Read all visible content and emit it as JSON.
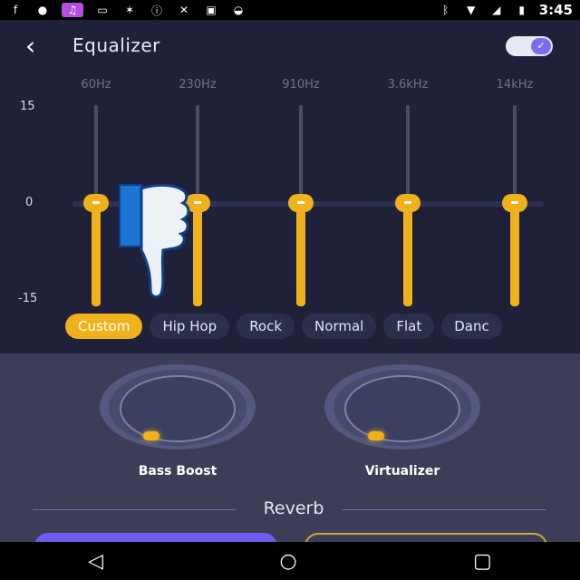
{
  "status_bar": {
    "time": "3:45",
    "icons_left": [
      "facebook-icon",
      "person-icon",
      "music-icon",
      "message-icon",
      "weather-icon",
      "alert-icon",
      "fan-icon",
      "lock-icon",
      "android-icon"
    ],
    "icons_right": [
      "bluetooth-icon",
      "wifi-icon",
      "signal-icon",
      "battery-icon"
    ]
  },
  "header": {
    "title": "Equalizer",
    "toggle_enabled": true
  },
  "eq": {
    "frequencies": [
      "60Hz",
      "230Hz",
      "910Hz",
      "3.6kHz",
      "14kHz"
    ],
    "y_labels": {
      "top": "15",
      "mid": "0",
      "bottom": "-15"
    },
    "gain_values_db": [
      0,
      0,
      0,
      0,
      0
    ]
  },
  "presets": {
    "items": [
      "Custom",
      "Hip Hop",
      "Rock",
      "Normal",
      "Flat",
      "Danc"
    ],
    "active": "Custom"
  },
  "effects": {
    "bass_boost_label": "Bass Boost",
    "virtualizer_label": "Virtualizer",
    "reverb_label": "Reverb"
  },
  "colors": {
    "accent": "#f0b21c",
    "background": "#1f2138",
    "panel": "#3c3e58",
    "toggle": "#7e6cf0"
  }
}
